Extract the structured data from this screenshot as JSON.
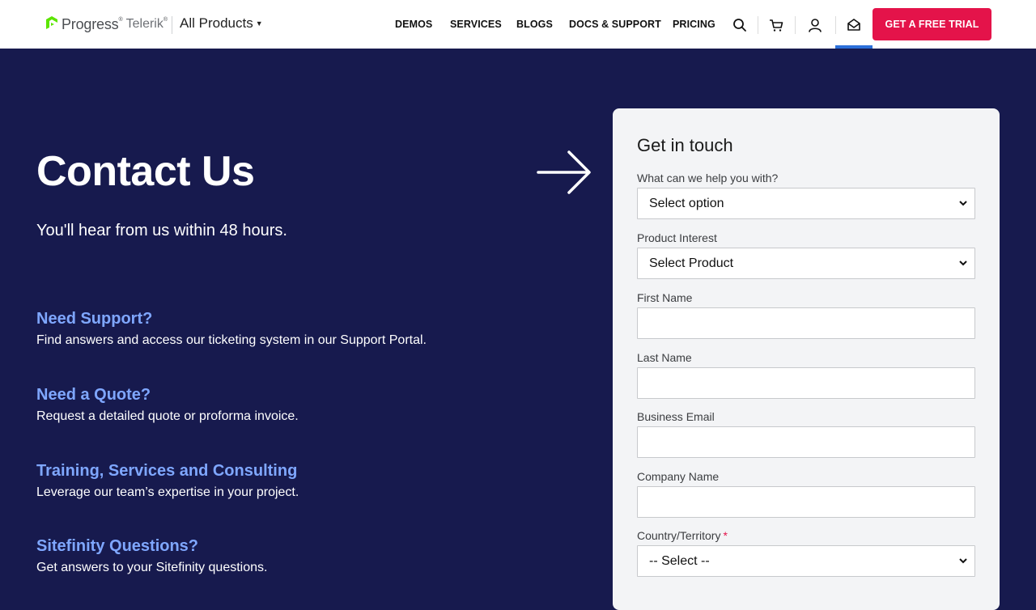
{
  "nav": {
    "logo_progress": "Progress",
    "logo_telerik": "Telerik",
    "logo_sup": "®",
    "all_products": "All Products",
    "links": [
      "DEMOS",
      "SERVICES",
      "BLOGS",
      "DOCS & SUPPORT",
      "PRICING"
    ],
    "cta": "GET A FREE TRIAL",
    "icons": [
      "search-icon",
      "cart-icon",
      "user-icon",
      "contact-envelope-icon"
    ],
    "active_color": "#2b6fd9",
    "cta_color": "#e4134a"
  },
  "hero": {
    "title": "Contact Us",
    "subtitle": "You'll hear from us within 48 hours.",
    "background": "#171a4e"
  },
  "info": [
    {
      "title": "Need Support?",
      "text": "Find answers and access our ticketing system in our Support Portal."
    },
    {
      "title": "Need a Quote?",
      "text": "Request a detailed quote or proforma invoice."
    },
    {
      "title": "Training, Services and Consulting",
      "text": "Leverage our team’s expertise in your project."
    },
    {
      "title": "Sitefinity Questions?",
      "text": "Get answers to your Sitefinity questions."
    }
  ],
  "form": {
    "title": "Get in touch",
    "help_label": "What can we help you with?",
    "help_value": "Select option",
    "product_label": "Product Interest",
    "product_value": "Select Product",
    "first_name_label": "First Name",
    "first_name_value": "",
    "last_name_label": "Last Name",
    "last_name_value": "",
    "email_label": "Business Email",
    "email_value": "",
    "company_label": "Company Name",
    "company_value": "",
    "country_label": "Country/Territory",
    "country_required": "*",
    "country_value": "-- Select --"
  }
}
